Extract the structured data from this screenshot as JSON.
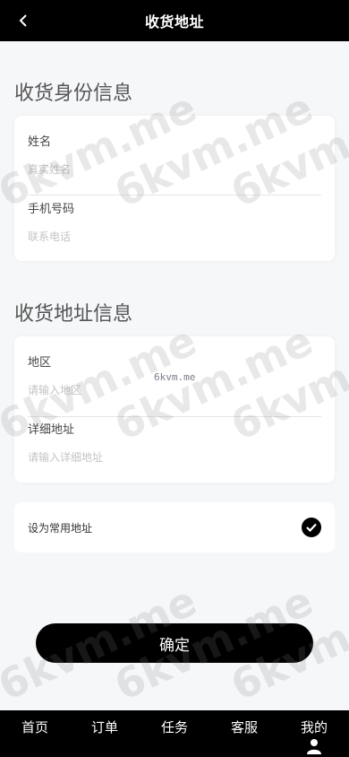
{
  "header": {
    "title": "收货地址"
  },
  "identity": {
    "section_title": "收货身份信息",
    "name": {
      "label": "姓名",
      "placeholder": "真实姓名",
      "value": ""
    },
    "phone": {
      "label": "手机号码",
      "placeholder": "联系电话",
      "value": ""
    }
  },
  "address": {
    "section_title": "收货地址信息",
    "region": {
      "label": "地区",
      "placeholder": "请输入地区",
      "value": ""
    },
    "detail": {
      "label": "详细地址",
      "placeholder": "请输入详细地址",
      "value": ""
    }
  },
  "default_address": {
    "label": "设为常用地址",
    "checked": true
  },
  "confirm_label": "确定",
  "tabs": [
    {
      "label": "首页"
    },
    {
      "label": "订单"
    },
    {
      "label": "任务"
    },
    {
      "label": "客服"
    },
    {
      "label": "我的",
      "icon": "user-icon"
    }
  ],
  "watermark": "6kvm.me",
  "colors": {
    "header_bg": "#000000",
    "accent": "#000000",
    "background": "#f6f7f9"
  }
}
